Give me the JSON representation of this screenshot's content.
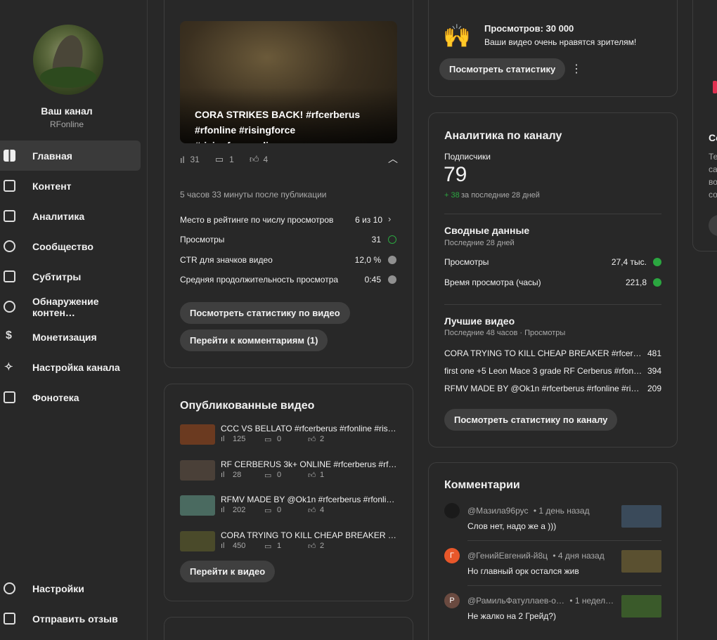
{
  "channel": {
    "title": "Ваш канал",
    "name": "RFonline"
  },
  "nav": [
    {
      "label": "Главная",
      "icon": "dashboard-icon"
    },
    {
      "label": "Контент",
      "icon": "content-icon"
    },
    {
      "label": "Аналитика",
      "icon": "analytics-icon"
    },
    {
      "label": "Сообщество",
      "icon": "community-icon"
    },
    {
      "label": "Субтитры",
      "icon": "subtitles-icon"
    },
    {
      "label": "Обнаружение контен…",
      "icon": "copyright-icon"
    },
    {
      "label": "Монетизация",
      "icon": "dollar-icon"
    },
    {
      "label": "Настройка канала",
      "icon": "magic-wand-icon"
    },
    {
      "label": "Фонотека",
      "icon": "music-library-icon"
    }
  ],
  "nav_bottom": [
    {
      "label": "Настройки",
      "icon": "gear-icon"
    },
    {
      "label": "Отправить отзыв",
      "icon": "feedback-icon"
    }
  ],
  "latest_video": {
    "title": "CORA STRIKES BACK! #rfcerberus #rfonline #risingforce #risingforceonline…",
    "views": "31",
    "comments": "1",
    "likes": "4",
    "published": "5 часов 33 минуты после публикации",
    "rows": [
      {
        "label": "Место в рейтинге по числу просмотров",
        "value": "6 из 10"
      },
      {
        "label": "Просмотры",
        "value": "31"
      },
      {
        "label": "CTR для значков видео",
        "value": "12,0 %"
      },
      {
        "label": "Средняя продолжительность просмотра",
        "value": "0:45"
      }
    ],
    "btn_stats": "Посмотреть статистику по видео",
    "btn_comments": "Перейти к комментариям (1)"
  },
  "published": {
    "heading": "Опубликованные видео",
    "videos": [
      {
        "title": "CCC VS BELLATO #rfcerberus #rfonline #rising…",
        "views": "125",
        "comments": "0",
        "likes": "2",
        "color": "#6b3a20"
      },
      {
        "title": "RF CERBERUS 3k+ ONLINE #rfcerberus #rfonli…",
        "views": "28",
        "comments": "0",
        "likes": "1",
        "color": "#4a4038"
      },
      {
        "title": "RFMV MADE BY @Ok1n #rfcerberus #rfonline …",
        "views": "202",
        "comments": "0",
        "likes": "4",
        "color": "#4a6a60"
      },
      {
        "title": "CORA TRYING TO KILL CHEAP BREAKER #rfce…",
        "views": "450",
        "comments": "1",
        "likes": "2",
        "color": "#4a4a2a"
      }
    ],
    "btn": "Перейти к видео"
  },
  "milestone": {
    "title": "Просмотров: 30 000",
    "text": "Ваши видео очень нравятся зрителям!",
    "btn": "Посмотреть статистику"
  },
  "analytics": {
    "heading": "Аналитика по каналу",
    "subs_label": "Подписчики",
    "subs_value": "79",
    "subs_delta": "+ 38",
    "subs_period": "за последние 28 дней",
    "summary_title": "Сводные данные",
    "summary_period": "Последние 28 дней",
    "summary_rows": [
      {
        "label": "Просмотры",
        "value": "27,4 тыс."
      },
      {
        "label": "Время просмотра (часы)",
        "value": "221,8"
      }
    ],
    "best_title": "Лучшие видео",
    "best_period": "Последние 48 часов · Просмотры",
    "best": [
      {
        "title": "CORA TRYING TO KILL CHEAP BREAKER #rfcerberus…",
        "value": "481"
      },
      {
        "title": "first one +5 Leon Mace 3 grade RF Cerberus #rfonlin…",
        "value": "394"
      },
      {
        "title": "RFMV MADE BY @Ok1n #rfcerberus #rfonline #risin…",
        "value": "209"
      }
    ],
    "btn": "Посмотреть статистику по каналу"
  },
  "comments": {
    "heading": "Комментарии",
    "items": [
      {
        "author": "@Мазила96рус",
        "time": "• 1 день назад",
        "text": "Слов нет, надо же а )))",
        "initial": "",
        "avatar_color": "#1a1a1a",
        "thumb_color": "#3a4a5a"
      },
      {
        "author": "@ГенийЕвгений-й8ц",
        "time": "• 4 дня назад",
        "text": "Но главный орк остался жив",
        "initial": "Г",
        "avatar_color": "#e8572a",
        "thumb_color": "#5a5030"
      },
      {
        "author": "@РамильФатуллаев-о…",
        "time": "• 1 недел…",
        "text": "Не жалко на 2 Грейд?)",
        "initial": "Р",
        "avatar_color": "#6a4a40",
        "thumb_color": "#3a5a2a"
      }
    ]
  },
  "right_partial": {
    "heading": "Co",
    "lines": [
      "Те",
      "са",
      "во",
      "со"
    ]
  }
}
